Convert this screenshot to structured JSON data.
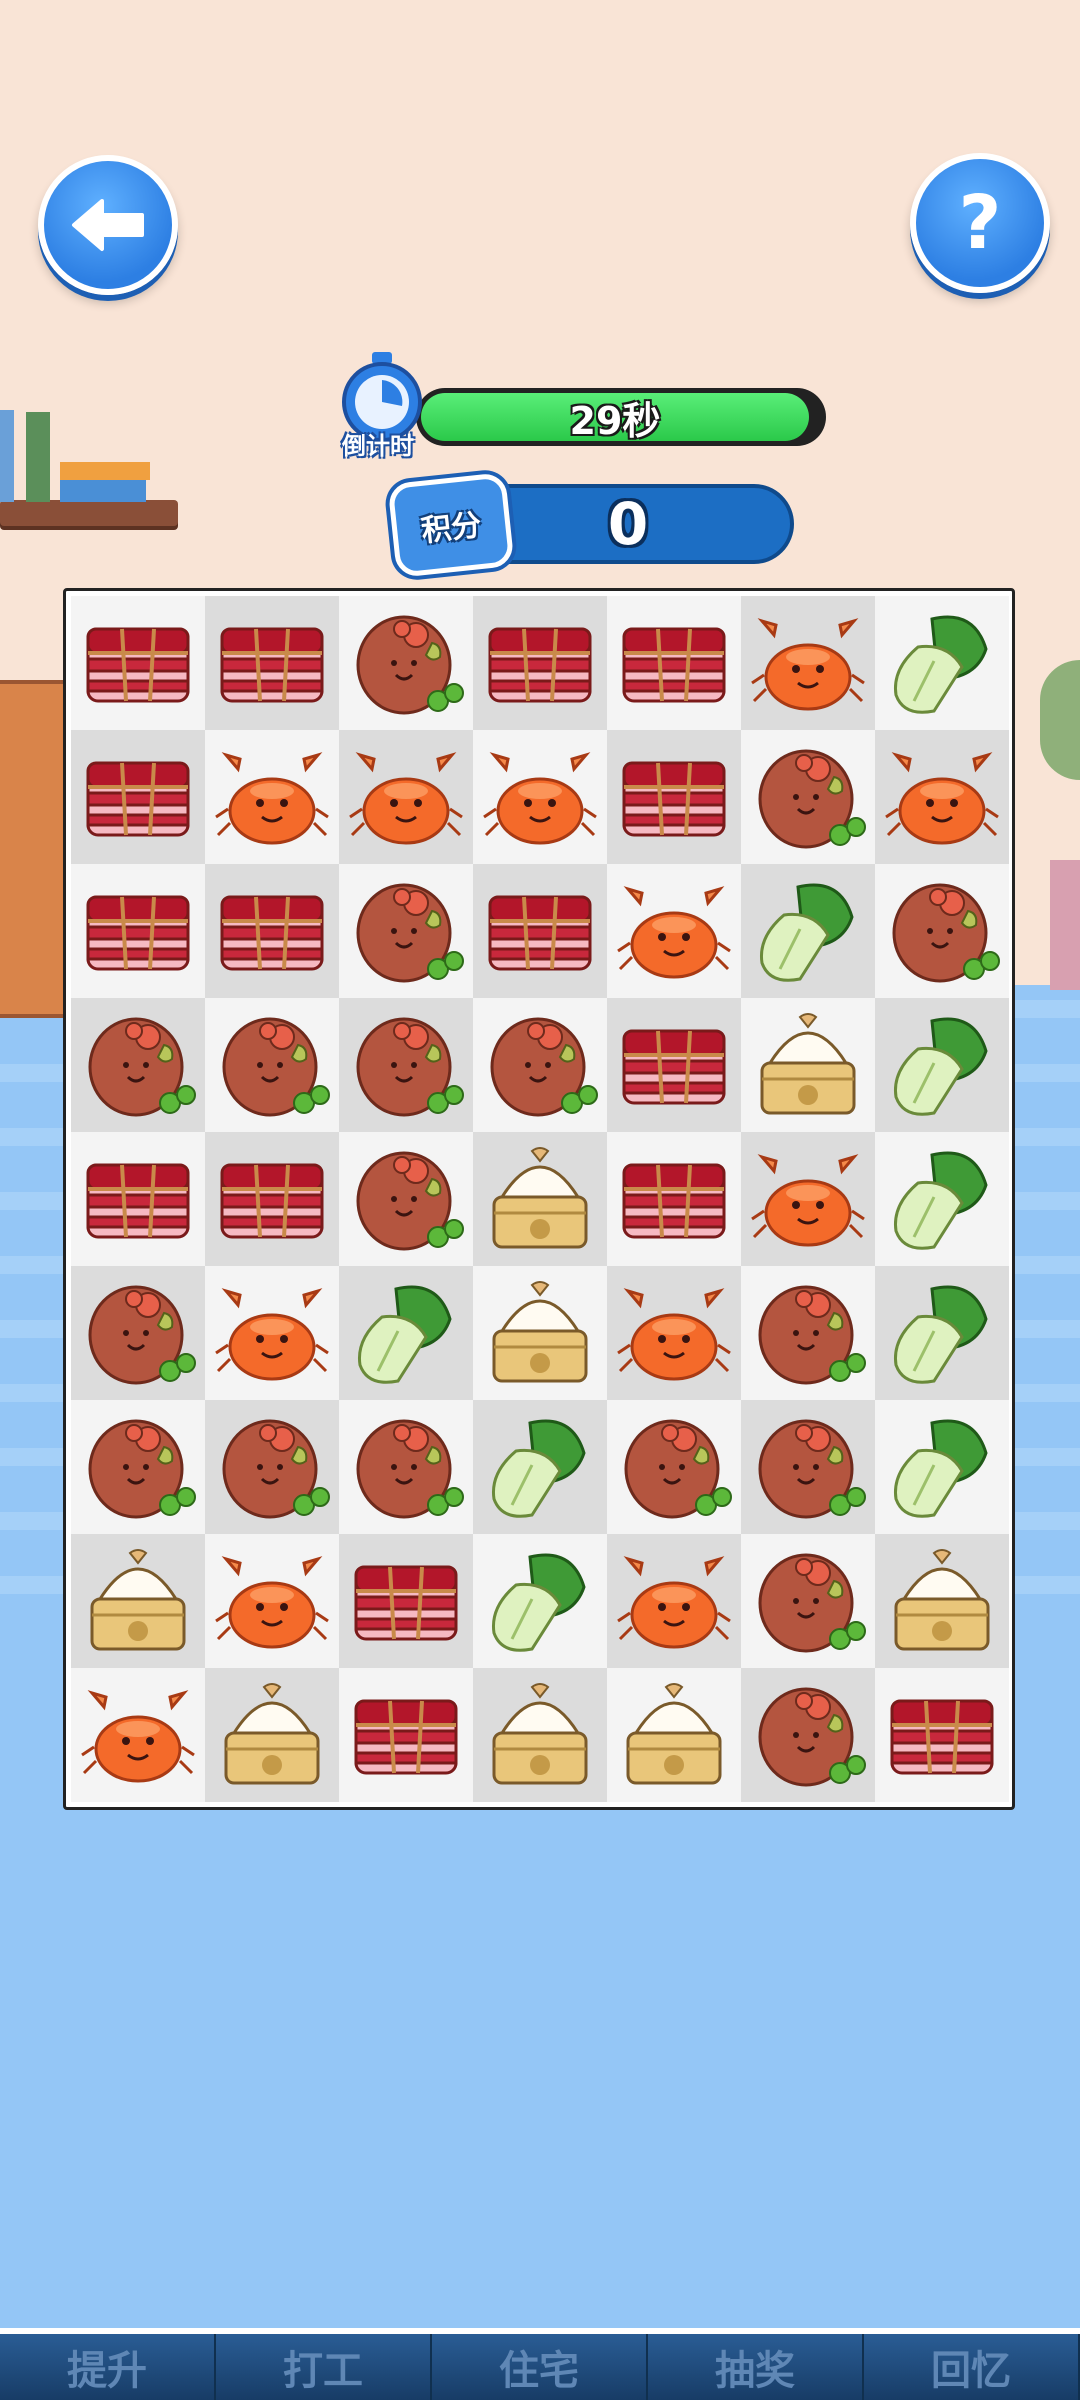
{
  "header": {
    "back_button": {
      "icon": "arrow-left-icon"
    },
    "help_button": {
      "icon": "question-icon",
      "label": "?"
    }
  },
  "timer": {
    "label": "倒计时",
    "value": "29秒",
    "remaining_fraction": 0.97
  },
  "score": {
    "label": "积分",
    "value": "0"
  },
  "board": {
    "rows": 9,
    "cols": 7,
    "grid": [
      [
        "pork",
        "pork",
        "meatball",
        "pork",
        "pork",
        "crab",
        "bokchoy"
      ],
      [
        "pork",
        "crab",
        "crab",
        "crab",
        "pork",
        "meatball",
        "crab"
      ],
      [
        "pork",
        "pork",
        "meatball",
        "pork",
        "crab",
        "bokchoy",
        "meatball"
      ],
      [
        "meatball",
        "meatball",
        "meatball",
        "meatball",
        "pork",
        "bun",
        "bokchoy"
      ],
      [
        "pork",
        "pork",
        "meatball",
        "bun",
        "pork",
        "crab",
        "bokchoy"
      ],
      [
        "meatball",
        "crab",
        "bokchoy",
        "bun",
        "crab",
        "meatball",
        "bokchoy"
      ],
      [
        "meatball",
        "meatball",
        "meatball",
        "bokchoy",
        "meatball",
        "meatball",
        "bokchoy"
      ],
      [
        "bun",
        "crab",
        "pork",
        "bokchoy",
        "crab",
        "meatball",
        "bun"
      ],
      [
        "crab",
        "bun",
        "pork",
        "bun",
        "bun",
        "meatball",
        "pork"
      ]
    ]
  },
  "bottom_nav": {
    "items": [
      "提升",
      "打工",
      "住宅",
      "抽奖",
      "回忆"
    ]
  }
}
